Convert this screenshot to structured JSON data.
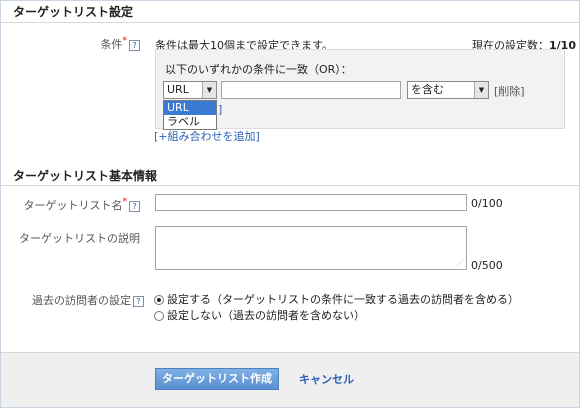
{
  "target_settings": {
    "section_title": "ターゲットリスト設定",
    "condition_label": "条件",
    "condition_note": "条件は最大10個まで設定できます。",
    "current_count_label": "現在の設定数：",
    "current_count_value": "1/10",
    "match_rule_text": "以下のいずれかの条件に一致（OR）：",
    "field_select_value": "URL",
    "field_options": [
      "URL",
      "ラベル"
    ],
    "operator_select_value": "を含む",
    "delete_link": "[削除]",
    "partial_link": "]",
    "add_combination_link": "[+組み合わせを追加]"
  },
  "basic_info": {
    "section_title": "ターゲットリスト基本情報",
    "name_label": "ターゲットリスト名",
    "name_counter": "0/100",
    "description_label": "ターゲットリストの説明",
    "description_counter": "0/500",
    "past_visitors_label": "過去の訪問者の設定",
    "radio_include": "設定する（ターゲットリストの条件に一致する過去の訪問者を含める）",
    "radio_exclude": "設定しない（過去の訪問者を含めない）"
  },
  "footer": {
    "create_button": "ターゲットリスト作成",
    "cancel_link": "キャンセル"
  },
  "icons": {
    "help": "?",
    "required": "*",
    "dropdown_arrow": "▼",
    "resize": "⋰"
  },
  "colors": {
    "link": "#2c5fb5",
    "primary_button": "#6a9fdc",
    "selected_option": "#3a7ad5",
    "required": "#dd0000"
  }
}
